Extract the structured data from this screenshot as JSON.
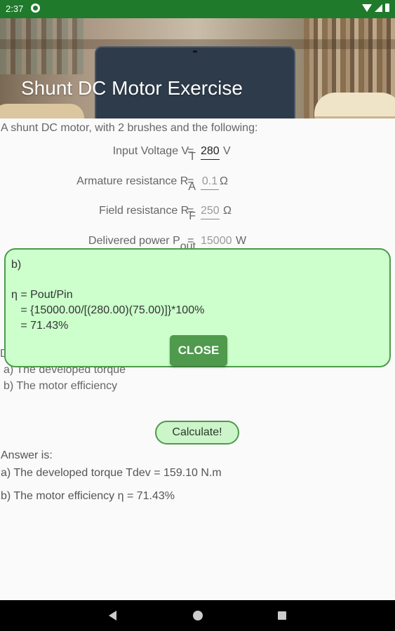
{
  "status_bar": {
    "time": "2:37"
  },
  "header": {
    "title": "Shunt DC Motor Exercise"
  },
  "intro": "A shunt DC motor, with 2 brushes and the following:",
  "params": [
    {
      "label": "Input Voltage V",
      "sub": "T",
      "eq": "=",
      "value": "280",
      "unit": "V"
    },
    {
      "label": "Armature resistance R",
      "sub": "A",
      "eq": "=",
      "value": "0.1",
      "unit": "Ω"
    },
    {
      "label": "Field resistance R",
      "sub": "F",
      "eq": "=",
      "value": "250",
      "unit": "Ω"
    },
    {
      "label": "Delivered power P",
      "sub": "out",
      "eq": "=",
      "value": "15000",
      "unit": "W"
    }
  ],
  "determine": {
    "heading": "D",
    "a": "a) The developed torque",
    "b": "b) The motor efficiency"
  },
  "calculate_label": "Calculate!",
  "answer": {
    "heading": "Answer is:",
    "a": "a) The developed torque Tdev = 159.10 N.m",
    "b": "b) The motor efficiency η = 71.43%"
  },
  "dialog": {
    "title": "b)",
    "line1": "η = Pout/Pin",
    "line2": "   = {15000.00/[(280.00)(75.00)]}*100%",
    "line3": "   = 71.43%",
    "close_label": "CLOSE"
  },
  "colors": {
    "status_bar": "#1f7a2c",
    "dialog_bg": "#ccffcc",
    "accent": "#4f9a4c",
    "button_bg": "#ccf5c9"
  },
  "icons": [
    "sync-icon",
    "wifi-icon",
    "signal-icon",
    "battery-icon",
    "back-icon",
    "home-icon",
    "recents-icon"
  ]
}
